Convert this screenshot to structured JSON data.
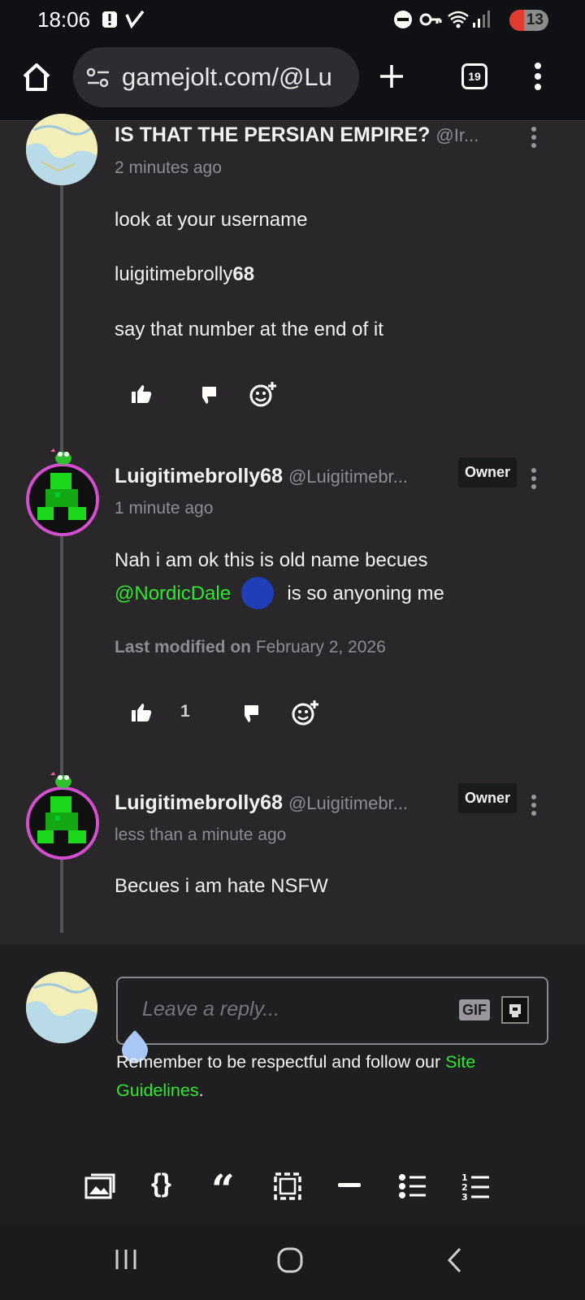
{
  "status_bar": {
    "time": "18:06",
    "battery": "13"
  },
  "browser": {
    "url": "gamejolt.com/@Lu",
    "tab_count": "19"
  },
  "comments": [
    {
      "name": "IS THAT THE PERSIAN EMPIRE?",
      "handle": "@Ir...",
      "time": "2 minutes ago",
      "paragraphs": [
        "look at your username",
        "luigitimebrolly",
        "say that number at the end of it"
      ],
      "bold_suffix": "68"
    },
    {
      "name": "Luigitimebrolly68",
      "handle": "@Luigitimebr...",
      "badge": "Owner",
      "time": "1 minute ago",
      "line1": "Nah i am ok this is old name becues",
      "mention": "@NordicDale",
      "line2_rest": "is so anyoning me",
      "modified_label": "Last modified on",
      "modified_date": "February 2, 2026",
      "like_count": "1"
    },
    {
      "name": "Luigitimebrolly68",
      "handle": "@Luigitimebr...",
      "badge": "Owner",
      "time": "less than a minute ago",
      "text": "Becues i am hate NSFW"
    }
  ],
  "reply": {
    "placeholder": "Leave a reply...",
    "gif_label": "GIF",
    "guideline_text": "Remember to be respectful and follow our",
    "guideline_link": "Site Guidelines",
    "guideline_end": "."
  },
  "colors": {
    "mention_green": "#2ee82e",
    "background": "#292729",
    "reply_bg": "#1f1e21"
  },
  "toolbar_icons": [
    "image-icon",
    "code-block-icon",
    "quote-icon",
    "spoiler-icon",
    "divider-icon",
    "bullet-list-icon",
    "numbered-list-icon"
  ]
}
